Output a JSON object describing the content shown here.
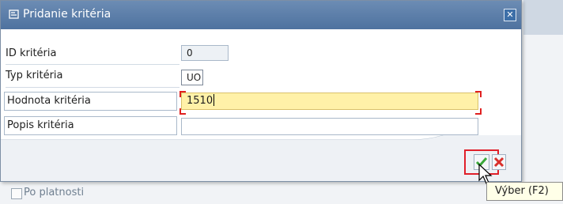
{
  "dialog": {
    "title": "Pridanie kritéria",
    "close_icon": "close-icon",
    "title_icon": "dialog-icon"
  },
  "form": {
    "rows": [
      {
        "label": "ID kritéria",
        "value": "0"
      },
      {
        "label": "Typ kritéria",
        "value": "UO"
      },
      {
        "label": "Hodnota kritéria",
        "value": "1510"
      },
      {
        "label": "Popis kritéria",
        "value": ""
      }
    ]
  },
  "buttons": {
    "ok_icon": "check-icon",
    "cancel_icon": "cancel-icon"
  },
  "tooltip": {
    "text": "Výber   (F2)"
  },
  "background": {
    "checkbox_label": "Po platnosti"
  },
  "colors": {
    "titlebar": "#5a7ea8",
    "active_field": "#fff1a8",
    "highlight_frame": "#e0202a",
    "ok_green": "#3aa83a",
    "cancel_red": "#d9302c"
  }
}
